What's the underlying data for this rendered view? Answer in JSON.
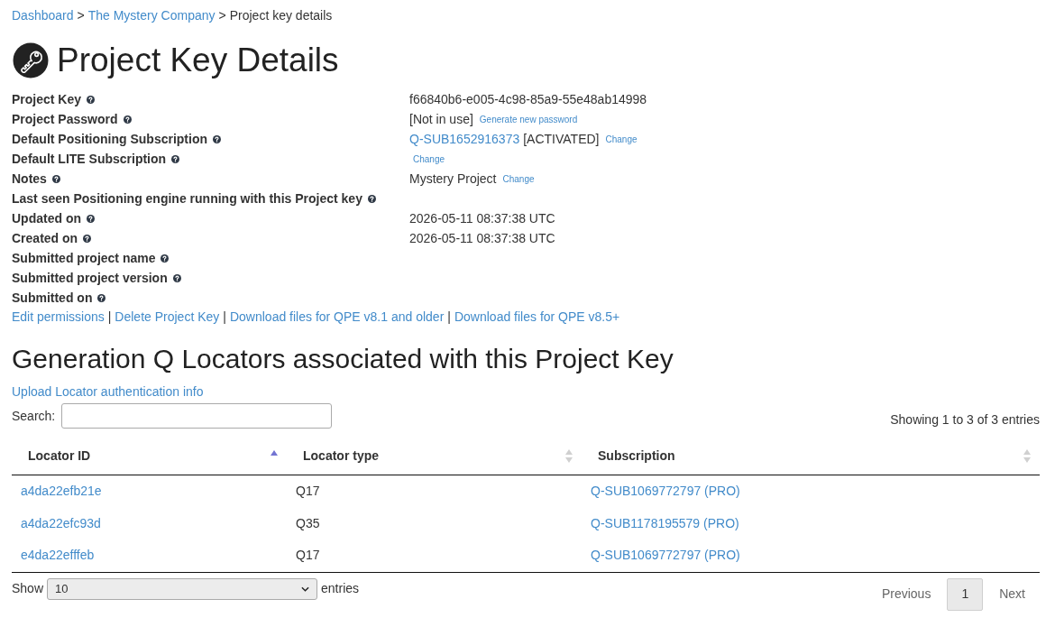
{
  "breadcrumb": [
    {
      "label": "Dashboard",
      "kind": "link"
    },
    {
      "separator": ">",
      "label": "The Mystery Company",
      "kind": "link"
    },
    {
      "separator": ">",
      "label": "Project key details",
      "kind": "current"
    }
  ],
  "page_title": "Project Key Details",
  "details": [
    {
      "label": "Project Key",
      "value": [
        {
          "kind": "text",
          "text": "f66840b6-e005-4c98-85a9-55e48ab14998"
        }
      ]
    },
    {
      "label": "Project Password",
      "value": [
        {
          "kind": "text",
          "text": "[Not in use]"
        },
        {
          "kind": "small_link",
          "text": "Generate new password"
        }
      ]
    },
    {
      "label": "Default Positioning Subscription",
      "value": [
        {
          "kind": "link",
          "text": "Q-SUB1652916373"
        },
        {
          "kind": "text",
          "text": "[ACTIVATED]"
        },
        {
          "kind": "small_link",
          "text": "Change"
        }
      ]
    },
    {
      "label": "Default LITE Subscription",
      "value": [
        {
          "kind": "small_link",
          "text": "Change"
        }
      ]
    },
    {
      "label": "Notes",
      "value": [
        {
          "kind": "text",
          "text": "Mystery Project"
        },
        {
          "kind": "small_link",
          "text": "Change"
        }
      ]
    },
    {
      "label": "Last seen Positioning engine running with this Project key"
    },
    {
      "label": "Updated on",
      "value": [
        {
          "kind": "text",
          "text": "2026-05-11 08:37:38 UTC"
        }
      ]
    },
    {
      "label": "Created on",
      "value": [
        {
          "kind": "text",
          "text": "2026-05-11 08:37:38 UTC"
        }
      ]
    },
    {
      "label": "Submitted project name"
    },
    {
      "label": "Submitted project version"
    },
    {
      "label": "Submitted on"
    }
  ],
  "actions": [
    {
      "label": "Edit permissions"
    },
    {
      "separator": "|",
      "label": "Delete Project Key"
    },
    {
      "separator": "|",
      "label": "Download files for QPE v8.1 and older"
    },
    {
      "separator": "|",
      "label": "Download files for QPE v8.5+"
    }
  ],
  "locators": {
    "title": "Generation Q Locators associated with this Project Key",
    "upload_link": "Upload Locator authentication info",
    "search": {
      "label": "Search:"
    },
    "info": "Showing 1 to 3 of 3 entries",
    "table": {
      "columns": [
        {
          "label": "Locator ID",
          "sorted": true
        },
        {
          "label": "Locator type",
          "sorted": false
        },
        {
          "label": "Subscription",
          "sorted": false
        }
      ],
      "rows": [
        {
          "cells": [
            {
              "kind": "link",
              "text": "a4da22efb21e"
            },
            {
              "kind": "text",
              "text": "Q17"
            },
            {
              "kind": "link",
              "text": "Q-SUB1069772797 (PRO)"
            }
          ]
        },
        {
          "cells": [
            {
              "kind": "link",
              "text": "a4da22efc93d"
            },
            {
              "kind": "text",
              "text": "Q35"
            },
            {
              "kind": "link",
              "text": "Q-SUB1178195579 (PRO)"
            }
          ]
        },
        {
          "cells": [
            {
              "kind": "link",
              "text": "e4da22efffeb"
            },
            {
              "kind": "text",
              "text": "Q17"
            },
            {
              "kind": "link",
              "text": "Q-SUB1069772797 (PRO)"
            }
          ]
        }
      ]
    },
    "length": {
      "label_before": "Show",
      "value": "10",
      "label_after": "entries"
    },
    "pagination": [
      {
        "label": "Previous",
        "selected": false,
        "disabled": true
      },
      {
        "label": "1",
        "selected": true,
        "disabled": false
      },
      {
        "label": "Next",
        "selected": false,
        "disabled": true
      }
    ]
  }
}
